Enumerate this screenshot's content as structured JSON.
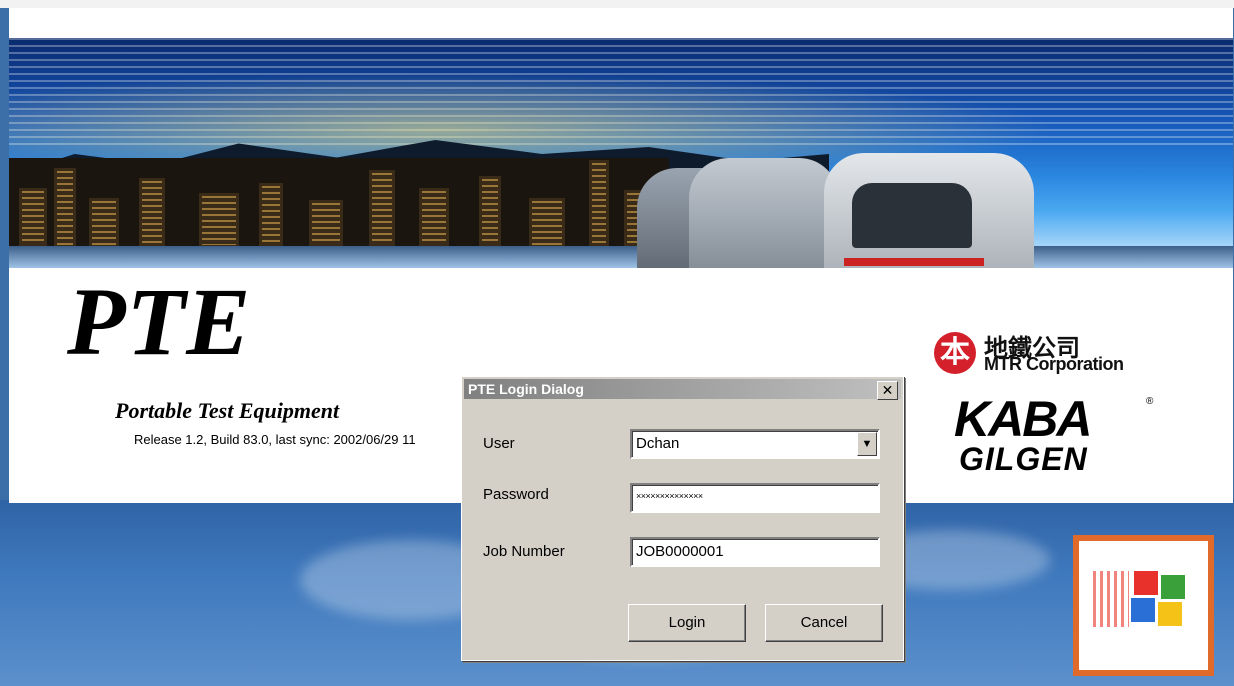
{
  "splash": {
    "title": "PTE",
    "subtitle": "Portable Test Equipment",
    "release": "Release 1.2, Build 83.0, last sync: 2002/06/29 11"
  },
  "logos": {
    "mtr_symbol": "本",
    "mtr_chinese": "地鐵公司",
    "mtr_english": "MTR Corporation",
    "kaba_top": "KABA",
    "kaba_reg": "®",
    "kaba_bottom": "GILGEN"
  },
  "dialog": {
    "title": "PTE Login Dialog",
    "close_glyph": "✕",
    "user_label": "User",
    "user_value": "Dchan",
    "dropdown_glyph": "▼",
    "password_label": "Password",
    "password_value": "××××××××××××××",
    "job_label": "Job Number",
    "job_value": "JOB0000001",
    "login_label": "Login",
    "cancel_label": "Cancel"
  },
  "colors": {
    "mtr_red": "#d4202b",
    "dialog_face": "#d4d0c8",
    "win_frame": "#e06a2a"
  }
}
